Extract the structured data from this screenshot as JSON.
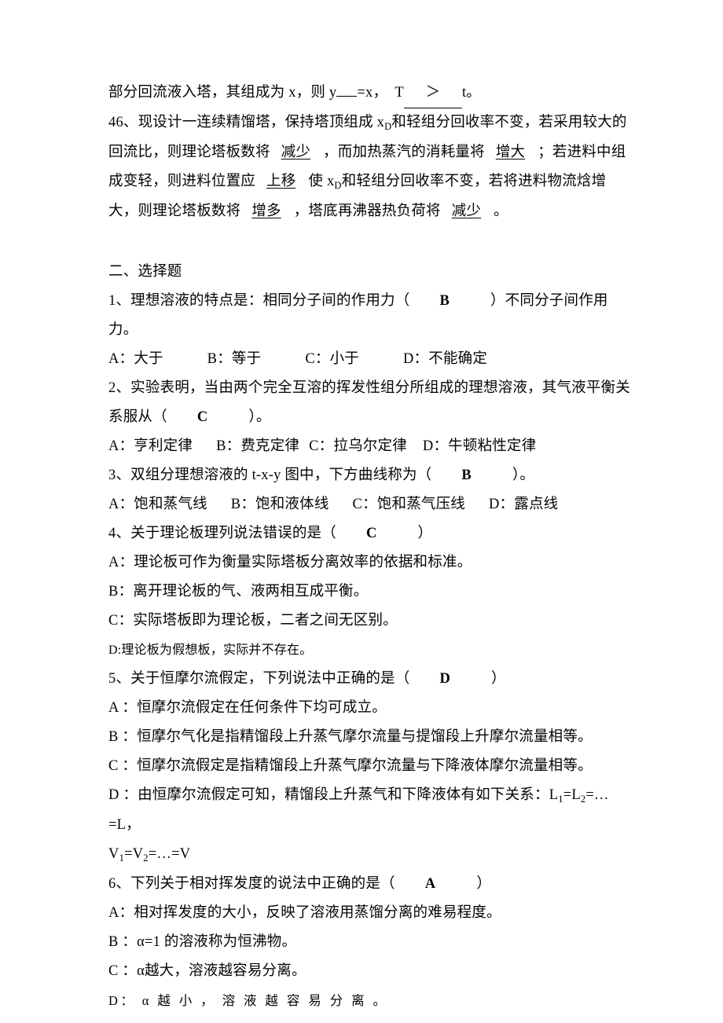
{
  "document": {
    "section_heading": "二、选择题",
    "fill_in": {
      "line_continued": {
        "pre": "部分回流液入塔，其组成为 x，则 y",
        "mid": "=x，  T",
        "gt": "＞",
        "post": "t。"
      },
      "q46": {
        "number": "46、",
        "seg1": "现设计一连续精馏塔，保持塔顶组成 x",
        "sub1": "D",
        "seg2": "和轻组分回收率不变，若采用较大的回流比，则理论塔板数将",
        "ans1": "减少",
        "seg3": "，而加热蒸汽的消耗量将",
        "ans2": "增大",
        "seg4": "；若进料中组成变轻，则进料位置应",
        "ans3": "上移",
        "seg5": "使 x",
        "sub2": "D",
        "seg6": "和轻组分回收率不变，若将进料物流焓增大，则理论塔板数将",
        "ans4": "增多",
        "seg7": "，塔底再沸器热负荷将",
        "ans5": "减少",
        "seg8": "。"
      }
    },
    "choice_questions": [
      {
        "stem_pre": "1、理想溶液的特点是：相同分子间的作用力（",
        "answer": "B",
        "stem_post": "）不同分子间作用力。",
        "options_line": [
          {
            "label": "A：",
            "text": "大于"
          },
          {
            "label": "B：",
            "text": "等于"
          },
          {
            "label": "C：",
            "text": "小于"
          },
          {
            "label": "D：",
            "text": "不能确定"
          }
        ]
      },
      {
        "stem_pre": "2、实验表明，当由两个完全互溶的挥发性组分所组成的理想溶液，其气液平衡关系服从（",
        "answer": "C",
        "stem_post": "）。",
        "options_line": [
          {
            "label": "A：",
            "text": "亨利定律"
          },
          {
            "label": "B：",
            "text": "费克定律"
          },
          {
            "label": "C：",
            "text": "拉乌尔定律"
          },
          {
            "label": "D：",
            "text": "牛顿粘性定律"
          }
        ]
      },
      {
        "stem_pre": "3、双组分理想溶液的 t-x-y 图中，下方曲线称为（",
        "answer": "B",
        "stem_post": "）。",
        "options_line": [
          {
            "label": "A：",
            "text": "饱和蒸气线"
          },
          {
            "label": "B：",
            "text": "饱和液体线"
          },
          {
            "label": "C：",
            "text": "饱和蒸气压线"
          },
          {
            "label": "D：",
            "text": "露点线"
          }
        ]
      },
      {
        "stem_pre": "4、关于理论板理列说法错误的是（",
        "answer": "C",
        "stem_post": "）",
        "options_block": [
          "A：理论板可作为衡量实际塔板分离效率的依据和标准。",
          "B：离开理论板的气、液两相互成平衡。",
          "C：实际塔板即为理论板，二者之间无区别。",
          "D:理论板为假想板，实际并不存在。"
        ]
      },
      {
        "stem_pre": "5、关于恒摩尔流假定，下列说法中正确的是（",
        "answer": "D",
        "stem_post": "）",
        "options_block": [
          "A ：恒摩尔流假定在任何条件下均可成立。",
          "B ：恒摩尔气化是指精馏段上升蒸气摩尔流量与提馏段上升摩尔流量相等。",
          "C ：恒摩尔流假定是指精馏段上升蒸气摩尔流量与下降液体摩尔流量相等。"
        ],
        "option_d": {
          "prefix": "D ：由恒摩尔流假定可知，精馏段上升蒸气和下降液体有如下关系：L",
          "sub1": "1",
          "mid1": "=L",
          "sub2": "2",
          "mid2": "=…=L，",
          "next_line_pre": "V",
          "sub3": "1",
          "mid3": "=V",
          "sub4": "2",
          "mid4": "=…=V"
        }
      },
      {
        "stem_pre": "6、下列关于相对挥发度的说法中正确的是（",
        "answer": "A",
        "stem_post": "）",
        "options_block": [
          "A：相对挥发度的大小，反映了溶液用蒸馏分离的难易程度。",
          "B ：α=1 的溶液称为恒沸物。",
          "C ：α越大，溶液越容易分离。"
        ],
        "option_d_wide": "D： α 越 小 ， 溶 液 越 容 易 分 离 。"
      }
    ]
  }
}
